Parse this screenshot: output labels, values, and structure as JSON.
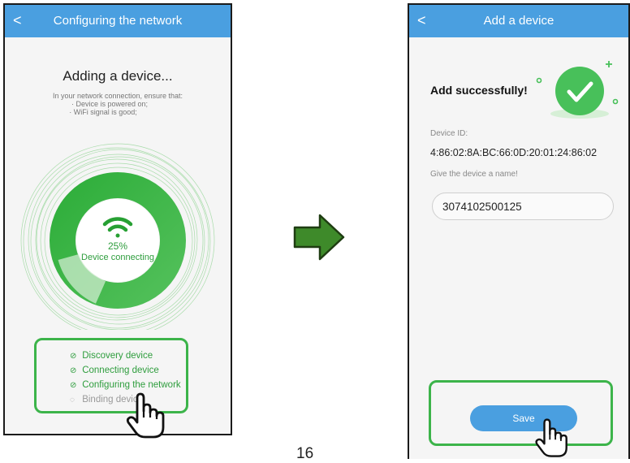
{
  "left_screen": {
    "header": {
      "back_icon": "chevron-left-icon",
      "back_glyph": "<",
      "title": "Configuring the network"
    },
    "heading": "Adding a device...",
    "instructions": [
      "In your network connection, ensure that:",
      "· Device is powered on;",
      "· WiFi signal is good;"
    ],
    "progress": {
      "percent_label": "25%",
      "value": 0.25,
      "status": "Device connecting"
    },
    "steps": [
      {
        "label": "Discovery device",
        "state": "done"
      },
      {
        "label": "Connecting device",
        "state": "done"
      },
      {
        "label": "Configuring the network",
        "state": "done"
      },
      {
        "label": "Binding device",
        "state": "pending"
      }
    ]
  },
  "arrow_icon": "right-arrow-icon",
  "page_number": "16",
  "right_screen": {
    "header": {
      "back_icon": "chevron-left-icon",
      "back_glyph": "<",
      "title": "Add a device"
    },
    "success_text": "Add successfully!",
    "device_id_label": "Device ID:",
    "device_id": "4:86:02:8A:BC:66:0D:20:01:24:86:02",
    "name_prompt": "Give the device a name!",
    "name_value": "3074102500125",
    "save_label": "Save"
  },
  "colors": {
    "header_blue": "#4a9fe0",
    "accent_green": "#3cb44a",
    "arrow_green": "#3e8a2a"
  }
}
